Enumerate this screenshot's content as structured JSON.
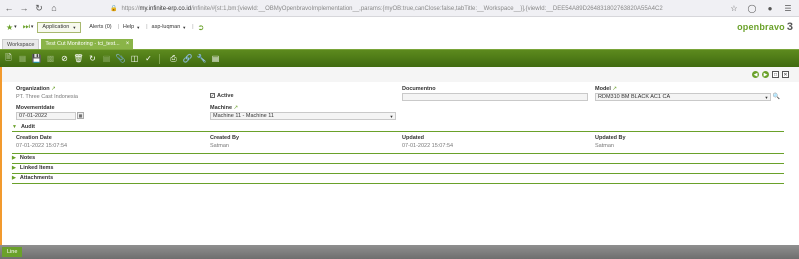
{
  "browser": {
    "url_scheme": "https://",
    "url_host": "my.infinite-erp.co.id",
    "url_rest": "/infinite/#[st:1,bm:[viewId:__OBMyOpenbravoImplementation__,params:{myOB:true,canClose:false,tabTitle:__Workspace__}],{viewId:__DEE54A89D264831802763820A55A4C2",
    "back_icon": "back-arrow-icon",
    "forward_icon": "forward-arrow-icon",
    "reload_icon": "reload-icon",
    "home_icon": "home-icon"
  },
  "appbar": {
    "menu_label": "Application",
    "alerts_label": "Alerts (0)",
    "help_label": "Help",
    "user_label": "asp-luqman",
    "logo_text": "openbravo",
    "logo_number": "3"
  },
  "tabs": {
    "workspace": "Workspace",
    "active": "Test Cut Monitoring - tci_test...",
    "close": "×"
  },
  "form": {
    "organization_label": "Organization",
    "organization_value": "PT. Three Cast Indonesia",
    "active_label": "Active",
    "active_checked": "✓",
    "documentno_label": "Documentno",
    "documentno_value": "",
    "model_label": "Model",
    "model_value": "RDM310 BM BLACK AC1 CA",
    "movementdate_label": "Movementdate",
    "movementdate_value": "07-01-2022",
    "machine_label": "Machine",
    "machine_value": "Machine 11 - Machine 11"
  },
  "audit": {
    "section_label": "Audit",
    "creation_date_label": "Creation Date",
    "creation_date_value": "07-01-2022 15:07:54",
    "created_by_label": "Created By",
    "created_by_value": "Satman",
    "updated_label": "Updated",
    "updated_value": "07-01-2022 15:07:54",
    "updated_by_label": "Updated By",
    "updated_by_value": "Satman"
  },
  "sections": {
    "notes": "Notes",
    "linked_items": "Linked Items",
    "attachments": "Attachments"
  },
  "bottom": {
    "line_tab": "Line"
  },
  "colors": {
    "brand_green": "#6aa12a",
    "toolbar_green": "#4c7816",
    "accent_orange": "#f29a2e"
  }
}
